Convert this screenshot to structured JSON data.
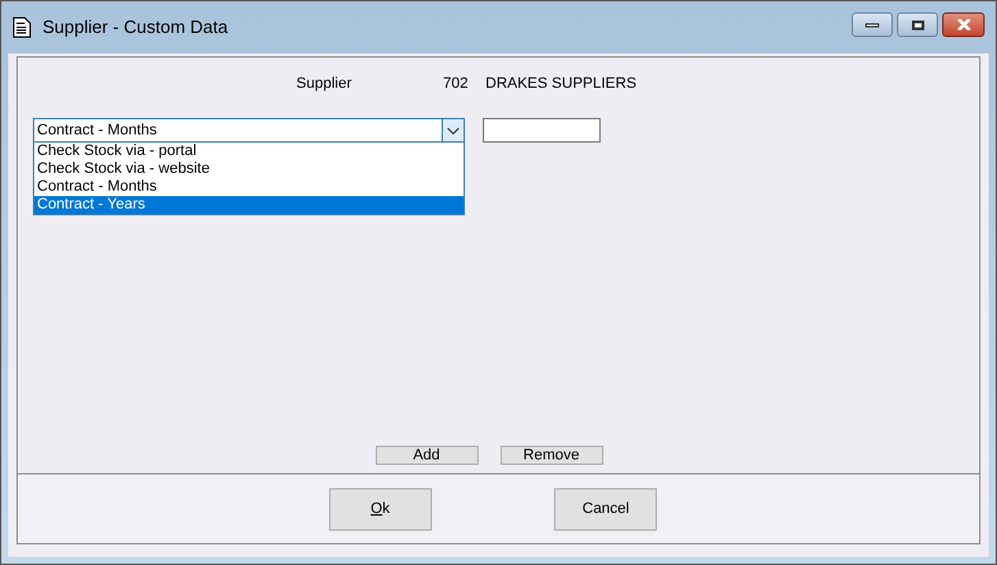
{
  "window": {
    "title": "Supplier - Custom Data"
  },
  "supplier": {
    "label": "Supplier",
    "number": "702",
    "name": "DRAKES SUPPLIERS"
  },
  "dropdown": {
    "value": "Contract - Months",
    "expanded": true,
    "options": [
      {
        "label": "Check Stock via - portal",
        "highlighted": false
      },
      {
        "label": "Check Stock via - website",
        "highlighted": false
      },
      {
        "label": "Contract - Months",
        "highlighted": false
      },
      {
        "label": "Contract - Years",
        "highlighted": true
      }
    ]
  },
  "list_buttons": [
    "Add",
    "Remove"
  ],
  "dialog_buttons": [
    {
      "label": "Ok",
      "underline_first": true
    },
    {
      "label": "Cancel",
      "underline_first": false
    }
  ]
}
